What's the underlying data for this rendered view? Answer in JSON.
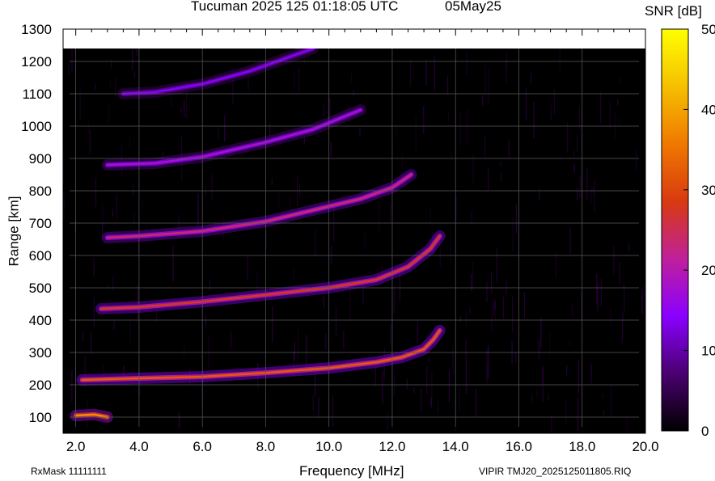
{
  "header": {
    "title": "Tucuman 2025 125 01:18:05 UTC",
    "date": "05May25"
  },
  "colorbar": {
    "title": "SNR [dB]",
    "min": 0,
    "max": 50,
    "ticks": [
      "0",
      "10",
      "20",
      "30",
      "40",
      "50"
    ],
    "tick_values": [
      0,
      10,
      20,
      30,
      40,
      50
    ],
    "colors": [
      "#000000",
      "#4a0070",
      "#8a00ff",
      "#c0209a",
      "#d83a10",
      "#f07800",
      "#f5c000",
      "#ffff00"
    ]
  },
  "footer": {
    "left": "RxMask 11111111",
    "right": "VIPIR  TMJ20_2025125011805.RIQ"
  },
  "chart_data": {
    "type": "heatmap",
    "title": "Tucuman 2025 125 01:18:05 UTC",
    "xlabel": "Frequency [MHz]",
    "ylabel": "Range [km]",
    "xlim": [
      1.6,
      20.0
    ],
    "ylim": [
      50,
      1300
    ],
    "data_ylim": [
      50,
      1240
    ],
    "xticks": [
      2.0,
      4.0,
      6.0,
      8.0,
      10.0,
      12.0,
      14.0,
      16.0,
      18.0,
      20.0
    ],
    "xtick_labels": [
      "2.0",
      "4.0",
      "6.0",
      "8.0",
      "10.0",
      "12.0",
      "14.0",
      "16.0",
      "18.0",
      "20.0"
    ],
    "yticks": [
      100,
      200,
      300,
      400,
      500,
      600,
      700,
      800,
      900,
      1000,
      1100,
      1200,
      1300
    ],
    "ytick_labels": [
      "100",
      "200",
      "300",
      "400",
      "500",
      "600",
      "700",
      "800",
      "900",
      "1000",
      "1100",
      "1200",
      "1300"
    ],
    "grid": true,
    "colorbar_label": "SNR [dB]",
    "traces": [
      {
        "name": "",
        "points": [
          [
            2.0,
            105
          ],
          [
            2.6,
            108
          ],
          [
            3.0,
            100
          ]
        ],
        "snr": 38
      },
      {
        "name": "",
        "points": [
          [
            2.2,
            215
          ],
          [
            4.0,
            220
          ],
          [
            6.0,
            225
          ],
          [
            8.0,
            237
          ],
          [
            10.0,
            252
          ],
          [
            11.5,
            270
          ],
          [
            12.3,
            285
          ],
          [
            13.0,
            310
          ],
          [
            13.3,
            340
          ],
          [
            13.5,
            368
          ]
        ],
        "snr": 32
      },
      {
        "name": "",
        "points": [
          [
            2.8,
            435
          ],
          [
            4.0,
            440
          ],
          [
            6.0,
            457
          ],
          [
            8.0,
            478
          ],
          [
            10.0,
            500
          ],
          [
            11.5,
            525
          ],
          [
            12.5,
            565
          ],
          [
            13.2,
            620
          ],
          [
            13.5,
            660
          ]
        ],
        "snr": 28
      },
      {
        "name": "",
        "points": [
          [
            3.0,
            655
          ],
          [
            4.0,
            660
          ],
          [
            6.0,
            675
          ],
          [
            8.0,
            705
          ],
          [
            9.5,
            740
          ],
          [
            11.0,
            775
          ],
          [
            12.0,
            810
          ],
          [
            12.6,
            850
          ]
        ],
        "snr": 24
      },
      {
        "name": "",
        "points": [
          [
            3.0,
            880
          ],
          [
            4.5,
            885
          ],
          [
            6.0,
            905
          ],
          [
            8.0,
            950
          ],
          [
            9.5,
            990
          ],
          [
            11.0,
            1050
          ]
        ],
        "snr": 18
      },
      {
        "name": "",
        "points": [
          [
            3.5,
            1100
          ],
          [
            4.5,
            1105
          ],
          [
            6.0,
            1130
          ],
          [
            7.5,
            1170
          ],
          [
            8.5,
            1205
          ],
          [
            9.5,
            1240
          ]
        ],
        "snr": 14
      }
    ]
  }
}
